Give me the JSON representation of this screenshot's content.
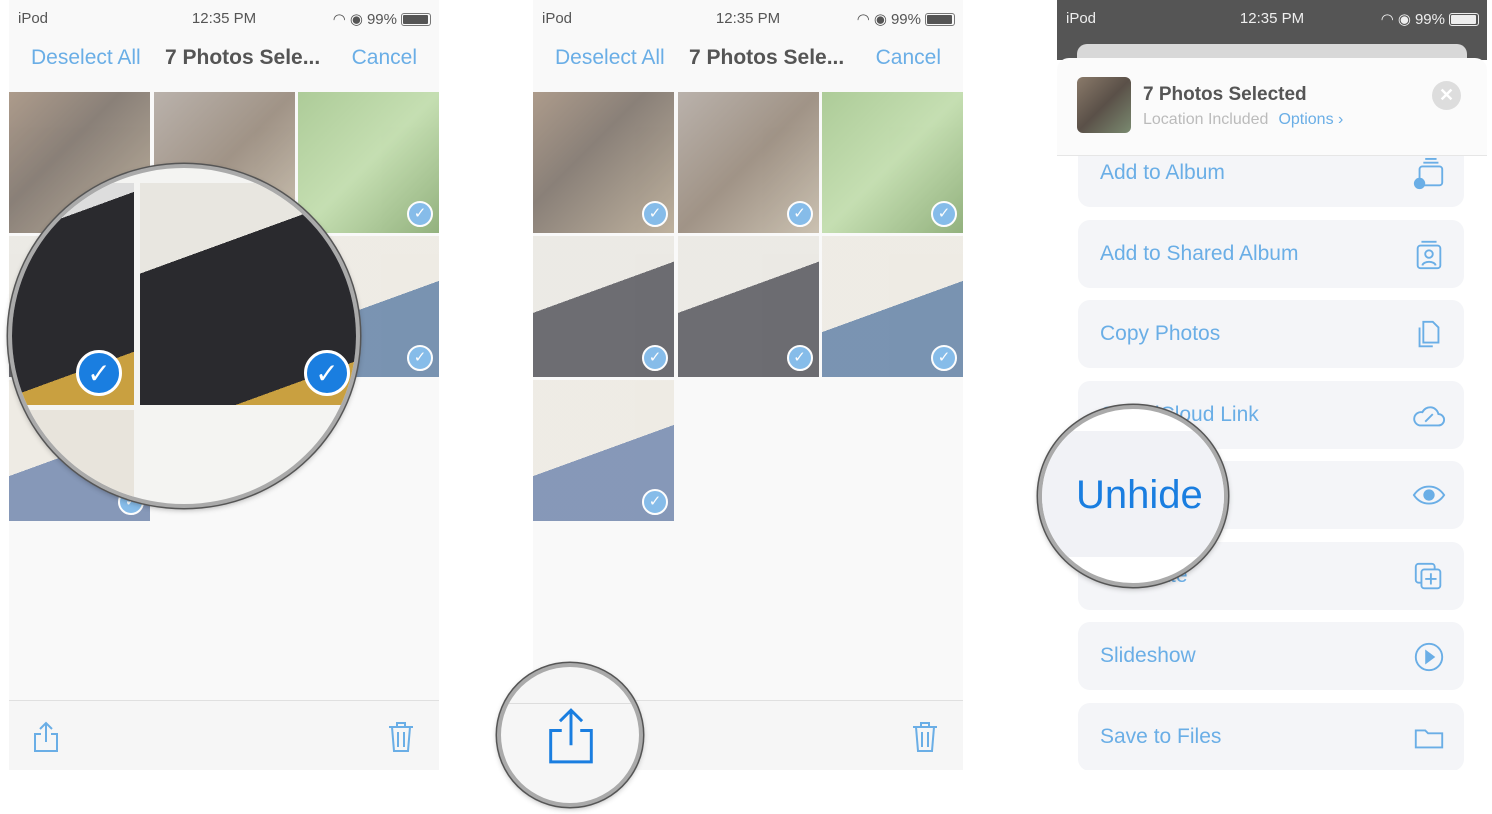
{
  "status": {
    "carrier": "iPod",
    "time": "12:35 PM",
    "battery": "99%"
  },
  "nav": {
    "deselect_all": "Deselect All",
    "title": "7 Photos Sele...",
    "cancel": "Cancel"
  },
  "panel1": {
    "photo_count": 7,
    "selected": [
      true,
      true,
      true,
      true,
      true,
      true,
      true
    ]
  },
  "share_sheet": {
    "title": "7 Photos Selected",
    "subtitle": "Location Included",
    "options": "Options",
    "options_chevron": "›",
    "close": "✕",
    "actions": [
      {
        "label": "Add to Album",
        "icon": "add-to-album-icon"
      },
      {
        "label": "Add to Shared Album",
        "icon": "shared-album-icon"
      },
      {
        "label": "Copy Photos",
        "icon": "copy-icon"
      },
      {
        "label": "Copy iCloud Link",
        "icon": "cloud-link-icon"
      },
      {
        "label": "Unhide",
        "icon": "eye-icon"
      },
      {
        "label": "Duplicate",
        "icon": "duplicate-icon"
      },
      {
        "label": "Slideshow",
        "icon": "play-circle-icon"
      },
      {
        "label": "Save to Files",
        "icon": "folder-icon"
      }
    ]
  },
  "magnifier_text": "Unhide",
  "colors": {
    "accent": "#1a7ee0",
    "accent_faded": "#6aaee6"
  }
}
